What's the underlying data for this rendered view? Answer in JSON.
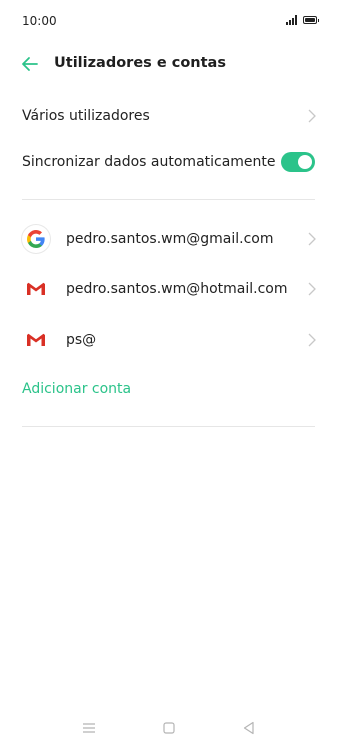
{
  "status_bar": {
    "time": "10:00",
    "icons": [
      "signal-icon",
      "battery-icon"
    ]
  },
  "header": {
    "title": "Utilizadores e contas",
    "back_icon": "back-arrow-icon"
  },
  "settings": {
    "multiple_users_label": "Vários utilizadores",
    "auto_sync_label": "Sincronizar dados automaticamente",
    "auto_sync_enabled": true
  },
  "accounts": [
    {
      "label": "pedro.santos.wm@gmail.com",
      "icon": "google-icon"
    },
    {
      "label": "pedro.santos.wm@hotmail.com",
      "icon": "gmail-icon"
    },
    {
      "label": "ps@",
      "icon": "gmail-icon"
    }
  ],
  "add_account_label": "Adicionar conta",
  "nav_bar": {
    "icons": [
      "menu-icon",
      "home-icon",
      "back-icon"
    ]
  },
  "colors": {
    "accent": "#2bc38a",
    "text": "#222222",
    "divider": "#e6e6e6",
    "gmail_red": "#d93025"
  }
}
